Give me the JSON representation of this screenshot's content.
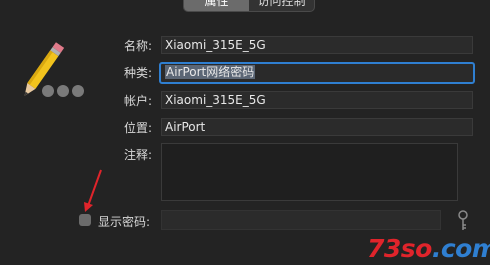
{
  "tabs": [
    {
      "label": "属性",
      "active": true
    },
    {
      "label": "访问控制",
      "active": false
    }
  ],
  "form": {
    "name_label": "名称:",
    "name_value": "Xiaomi_315E_5G",
    "kind_label": "种类:",
    "kind_value": "AirPort网络密码",
    "account_label": "帐户:",
    "account_value": "Xiaomi_315E_5G",
    "where_label": "位置:",
    "where_value": "AirPort",
    "comments_label": "注释:",
    "show_password_label": "显示密码:",
    "show_password_checked": false
  },
  "icons": {
    "item": "pencil-icon",
    "key": "key-icon",
    "annotation": "red-arrow"
  },
  "watermark": {
    "text_a": "73so",
    "text_b": ".com",
    "color_a": "#e0242b",
    "color_b": "#2f7fd1"
  }
}
